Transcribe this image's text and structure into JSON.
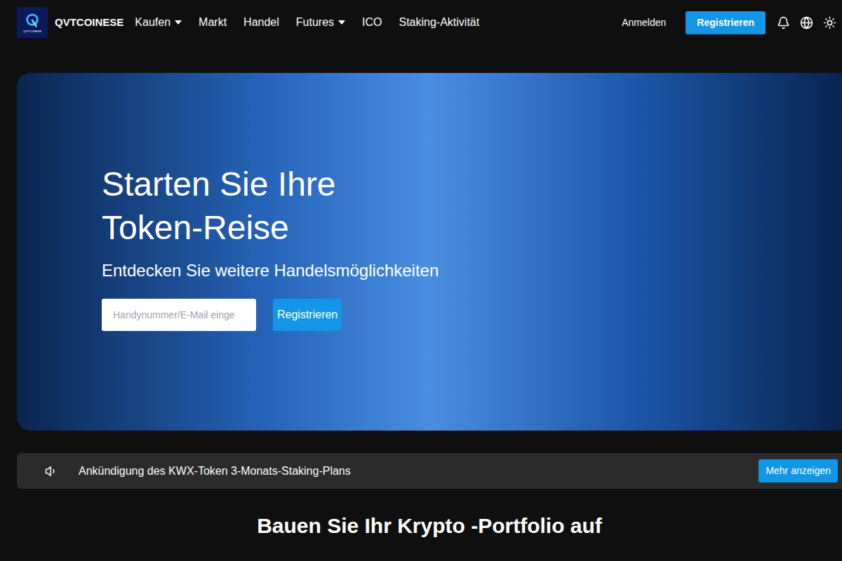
{
  "header": {
    "logo_caption": "QVTCOINESE",
    "brand": "QVTCOINESE",
    "nav": [
      {
        "label": "Kaufen",
        "dropdown": true
      },
      {
        "label": "Markt",
        "dropdown": false
      },
      {
        "label": "Handel",
        "dropdown": false
      },
      {
        "label": "Futures",
        "dropdown": true
      },
      {
        "label": "ICO",
        "dropdown": false
      },
      {
        "label": "Staking-Aktivität",
        "dropdown": false
      }
    ],
    "login": "Anmelden",
    "register": "Registrieren"
  },
  "hero": {
    "title_lines": [
      "Starten Sie Ihre",
      "Token-Reise"
    ],
    "subtitle": "Entdecken Sie weitere Handelsmöglichkeiten",
    "input_placeholder": "Handynummer/E-Mail einge",
    "button": "Registrieren"
  },
  "announcement": {
    "text": "Ankündigung des KWX-Token 3-Monats-Staking-Plans",
    "button": "Mehr anzeigen"
  },
  "section_title": "Bauen Sie Ihr Krypto -Portfolio auf"
}
